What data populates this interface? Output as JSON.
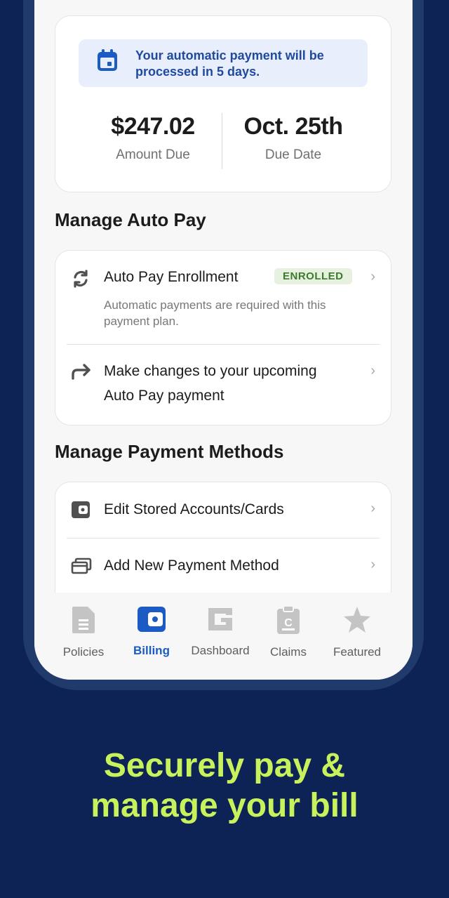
{
  "notice": {
    "text": "Your automatic payment will be processed in 5 days."
  },
  "summary": {
    "amount": "$247.02",
    "amount_label": "Amount Due",
    "due_date": "Oct. 25th",
    "due_date_label": "Due Date"
  },
  "autopay": {
    "title": "Manage Auto Pay",
    "enrollment_label": "Auto Pay Enrollment",
    "enrollment_badge": "ENROLLED",
    "enrollment_desc": "Automatic payments are required with this payment plan.",
    "changes_label_1": "Make changes to your upcoming",
    "changes_label_2": "Auto Pay payment"
  },
  "payment_methods": {
    "title": "Manage Payment Methods",
    "edit_label": "Edit Stored Accounts/Cards",
    "add_label": "Add New Payment Method"
  },
  "tabs": [
    {
      "label": "Policies",
      "icon": "policies-icon"
    },
    {
      "label": "Billing",
      "icon": "billing-icon",
      "active": true
    },
    {
      "label": "Dashboard",
      "icon": "dashboard-icon"
    },
    {
      "label": "Claims",
      "icon": "claims-icon"
    },
    {
      "label": "Featured",
      "icon": "featured-icon"
    }
  ],
  "headline": {
    "line1": "Securely pay &",
    "line2": "manage your bill"
  },
  "colors": {
    "background": "#0d2255",
    "accent": "#1d5bc4",
    "headline": "#c8f25c",
    "badge_text": "#3d7a2c"
  }
}
